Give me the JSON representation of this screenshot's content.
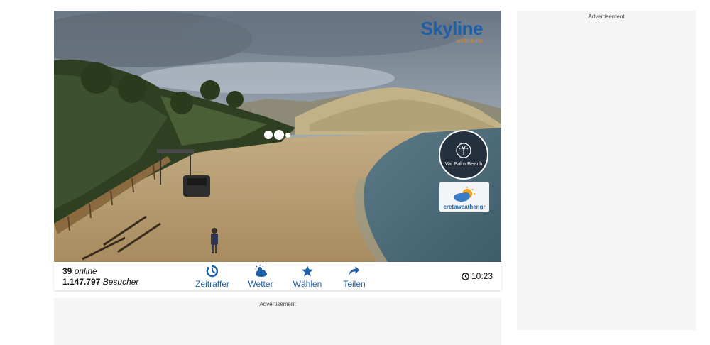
{
  "brand": {
    "name": "Skyline",
    "tagline": "webcams",
    "color": "#1f5fa8",
    "accent": "#e08a2a"
  },
  "player": {
    "location_badge": "Vai Palm Beach",
    "partner_badge": "cretaweather.gr",
    "loading_indicator": "loading-dots"
  },
  "stats": {
    "online_count": "39",
    "online_label": "online",
    "visitor_count": "1.147.797",
    "visitor_label": "Besucher"
  },
  "actions": [
    {
      "label": "Zeitraffer",
      "icon": "timelapse-icon"
    },
    {
      "label": "Wetter",
      "icon": "weather-icon"
    },
    {
      "label": "Wählen",
      "icon": "star-icon"
    },
    {
      "label": "Teilen",
      "icon": "share-icon"
    }
  ],
  "clock": {
    "time": "10:23",
    "icon": "clock-icon"
  },
  "ads": {
    "bottom_label": "Advertisement",
    "right_label": "Advertisement"
  }
}
